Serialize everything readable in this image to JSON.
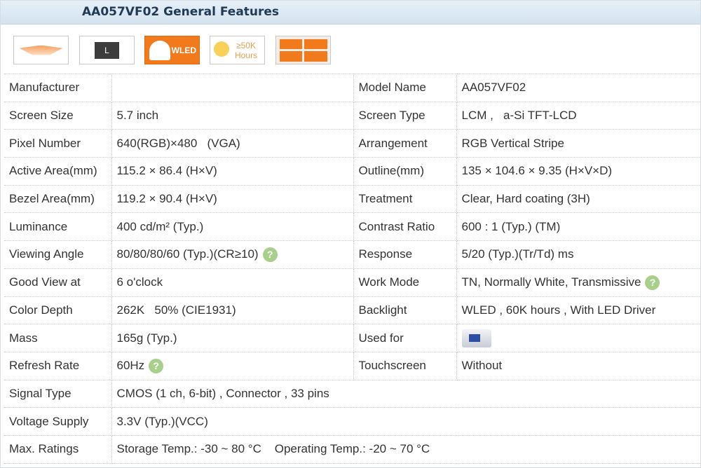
{
  "title": "AA057VF02 General Features",
  "icons": [
    {
      "name": "surface-treatment-icon"
    },
    {
      "name": "screen-size-l-icon",
      "label": "L"
    },
    {
      "name": "wled-icon",
      "label": "WLED"
    },
    {
      "name": "lifetime-icon",
      "label": "≥50K Hours"
    },
    {
      "name": "pixel-arrangement-icon"
    }
  ],
  "rows": [
    {
      "l": "Manufacturer",
      "v": "",
      "l2": "Model Name",
      "v2": "AA057VF02"
    },
    {
      "l": "Screen Size",
      "v": "5.7 inch",
      "l2": "Screen Type",
      "v2": "LCM ,   a-Si TFT-LCD"
    },
    {
      "l": "Pixel Number",
      "v": "640(RGB)×480   (VGA)",
      "l2": "Arrangement",
      "v2": "RGB Vertical Stripe"
    },
    {
      "l": "Active Area(mm)",
      "v": "115.2 × 86.4 (H×V)",
      "l2": "Outline(mm)",
      "v2": "135 × 104.6 × 9.35 (H×V×D)"
    },
    {
      "l": "Bezel Area(mm)",
      "v": "119.2 × 90.4 (H×V)",
      "l2": "Treatment",
      "v2": "Clear, Hard coating (3H)"
    },
    {
      "l": "Luminance",
      "v": "400 cd/m² (Typ.)",
      "l2": "Contrast Ratio",
      "v2": "600 : 1 (Typ.) (TM)"
    },
    {
      "l": "Viewing Angle",
      "v": "80/80/80/60 (Typ.)(CR≥10)",
      "l2": "Response",
      "v2": "5/20 (Typ.)(Tr/Td) ms"
    },
    {
      "l": "Good View at",
      "v": "6 o'clock",
      "l2": "Work Mode",
      "v2": "TN, Normally White, Transmissive"
    },
    {
      "l": "Color Depth",
      "v": "262K   50% (CIE1931)",
      "l2": "Backlight",
      "v2": "WLED , 60K hours , With LED Driver"
    },
    {
      "l": "Mass",
      "v": "165g (Typ.)",
      "l2": "Used for",
      "v2": ""
    },
    {
      "l": "Refresh Rate",
      "v": "60Hz",
      "l2": "Touchscreen",
      "v2": "Without"
    }
  ],
  "full_rows": [
    {
      "l": "Signal Type",
      "v": "CMOS (1 ch, 6-bit) , Connector , 33 pins"
    },
    {
      "l": "Voltage Supply",
      "v": "3.3V (Typ.)(VCC)"
    },
    {
      "l": "Max. Ratings",
      "v": "Storage Temp.: -30 ~ 80 °C    Operating Temp.: -20 ~ 70 °C"
    }
  ],
  "help_glyph": "?"
}
